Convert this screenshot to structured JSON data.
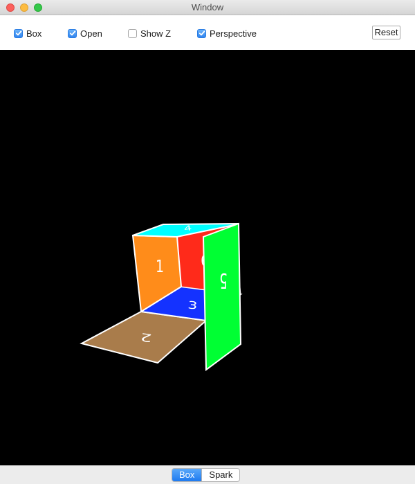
{
  "window": {
    "title": "Window"
  },
  "toolbar": {
    "checkboxes": [
      {
        "label": "Box",
        "checked": true
      },
      {
        "label": "Open",
        "checked": true
      },
      {
        "label": "Show Z",
        "checked": false
      },
      {
        "label": "Perspective",
        "checked": true
      }
    ],
    "reset_label": "Reset"
  },
  "scene": {
    "faces": [
      {
        "label": "1",
        "color": "#ff8c1a"
      },
      {
        "label": "2",
        "color": "#a97c4b"
      },
      {
        "label": "3",
        "color": "#1432ff"
      },
      {
        "label": "5",
        "color": "#00ff33"
      },
      {
        "label": "6",
        "color": "#ff2a1a"
      },
      {
        "label": "4",
        "color": "#00ffff"
      }
    ]
  },
  "bottom": {
    "segments": [
      {
        "label": "Box",
        "selected": true
      },
      {
        "label": "Spark",
        "selected": false
      }
    ]
  }
}
